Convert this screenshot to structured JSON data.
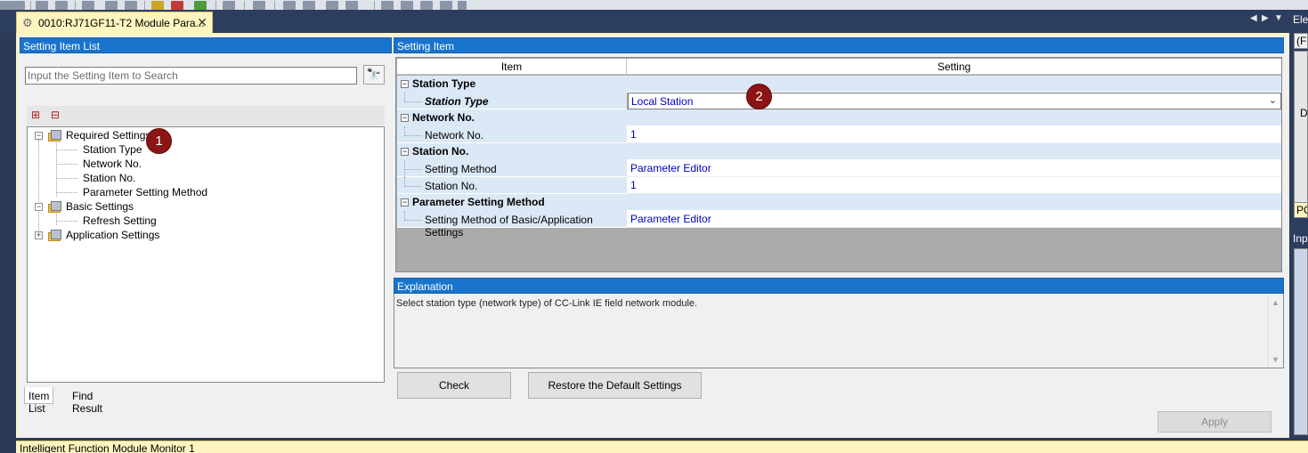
{
  "document_tab": {
    "title": "0010:RJ71GF11-T2 Module Para...",
    "close": "✕"
  },
  "tab_strip_controls": {
    "left": "◀",
    "right": "▶",
    "menu": "▼"
  },
  "left_panel": {
    "header": "Setting Item List",
    "search_placeholder": "Input the Setting Item to Search",
    "tree": [
      {
        "label": "Required Settings",
        "level": 0,
        "expanded": true
      },
      {
        "label": "Station Type",
        "level": 1
      },
      {
        "label": "Network No.",
        "level": 1
      },
      {
        "label": "Station No.",
        "level": 1
      },
      {
        "label": "Parameter Setting Method",
        "level": 1
      },
      {
        "label": "Basic Settings",
        "level": 0,
        "expanded": true
      },
      {
        "label": "Refresh Setting",
        "level": 1
      },
      {
        "label": "Application Settings",
        "level": 0,
        "expanded": false
      }
    ],
    "bottom_tabs": [
      "Item List",
      "Find Result"
    ]
  },
  "right_panel": {
    "header": "Setting Item",
    "columns": [
      "Item",
      "Setting"
    ],
    "rows": [
      {
        "type": "category",
        "label": "Station Type"
      },
      {
        "type": "item",
        "label": "Station Type",
        "value": "Local Station",
        "combo": true
      },
      {
        "type": "category",
        "label": "Network No."
      },
      {
        "type": "item",
        "label": "Network No.",
        "value": "1"
      },
      {
        "type": "category",
        "label": "Station No."
      },
      {
        "type": "item",
        "label": "Setting Method",
        "value": "Parameter Editor"
      },
      {
        "type": "item",
        "label": "Station No.",
        "value": "1"
      },
      {
        "type": "category",
        "label": "Parameter Setting Method"
      },
      {
        "type": "item",
        "label": "Setting Method of Basic/Application Settings",
        "value": "Parameter Editor"
      }
    ],
    "explanation_header": "Explanation",
    "explanation_text": "Select station type (network type) of CC-Link IE field network module.",
    "check_button": "Check",
    "restore_button": "Restore the Default Settings",
    "apply_button": "Apply"
  },
  "callouts": {
    "one": "1",
    "two": "2"
  },
  "dock": {
    "top_header": "Ele",
    "box1_text": "(Fi",
    "box2_text": "D",
    "tab_text": "PC",
    "lower_header": "Inp"
  },
  "bottom_bar": {
    "title": "Intelligent Function Module Monitor 1"
  },
  "colors": {
    "panel_header": "#1874cd",
    "category_row": "#dbe8f6",
    "value_text": "#0000c0",
    "callout": "#8b1414",
    "tab_active": "#fdf4bf"
  }
}
